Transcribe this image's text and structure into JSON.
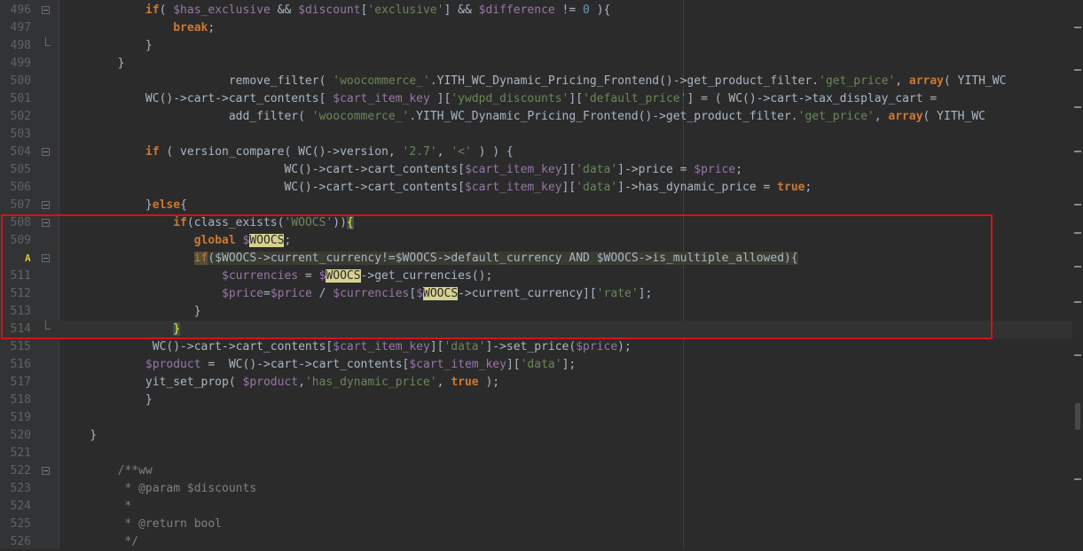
{
  "editor": {
    "current_line": "514",
    "lines": [
      {
        "n": "496",
        "fold": "open",
        "t": [
          [
            "            ",
            ""
          ],
          [
            "if",
            "kw"
          ],
          [
            "( ",
            ""
          ],
          [
            "$has_exclusive",
            "var"
          ],
          [
            " && ",
            ""
          ],
          [
            "$discount",
            "var"
          ],
          [
            "[",
            ""
          ],
          [
            "'exclusive'",
            "str"
          ],
          [
            "] && ",
            ""
          ],
          [
            "$difference",
            "var"
          ],
          [
            " != ",
            ""
          ],
          [
            "0",
            "num"
          ],
          [
            " ){",
            ""
          ]
        ]
      },
      {
        "n": "497",
        "t": [
          [
            "                ",
            ""
          ],
          [
            "break",
            "kw"
          ],
          [
            ";",
            ""
          ]
        ]
      },
      {
        "n": "498",
        "fold": "end",
        "t": [
          [
            "            }",
            ""
          ]
        ]
      },
      {
        "n": "499",
        "t": [
          [
            "        }",
            ""
          ]
        ]
      },
      {
        "n": "500",
        "t": [
          [
            "                        remove_filter( ",
            ""
          ],
          [
            "'woocommerce_'",
            "str"
          ],
          [
            ".YITH_WC_Dynamic_Pricing_Frontend()->get_product_filter.",
            ""
          ],
          [
            "'get_price'",
            "str"
          ],
          [
            ", ",
            ""
          ],
          [
            "array",
            "kw"
          ],
          [
            "( YITH_WC",
            ""
          ]
        ]
      },
      {
        "n": "501",
        "t": [
          [
            "            WC()->cart->cart_contents[ ",
            ""
          ],
          [
            "$cart_item_key",
            "var"
          ],
          [
            " ][",
            ""
          ],
          [
            "'ywdpd_discounts'",
            "str"
          ],
          [
            "][",
            ""
          ],
          [
            "'default_price'",
            "str"
          ],
          [
            "] = ( WC()->cart->tax_display_cart = ",
            ""
          ]
        ]
      },
      {
        "n": "502",
        "t": [
          [
            "                        add_filter( ",
            ""
          ],
          [
            "'woocommerce_'",
            "str"
          ],
          [
            ".YITH_WC_Dynamic_Pricing_Frontend()->get_product_filter.",
            ""
          ],
          [
            "'get_price'",
            "str"
          ],
          [
            ", ",
            ""
          ],
          [
            "array",
            "kw"
          ],
          [
            "( YITH_WC",
            ""
          ]
        ]
      },
      {
        "n": "503",
        "t": [
          [
            "",
            ""
          ]
        ]
      },
      {
        "n": "504",
        "fold": "open",
        "t": [
          [
            "            ",
            ""
          ],
          [
            "if",
            "kw"
          ],
          [
            " ( version_compare( WC()->version, ",
            ""
          ],
          [
            "'2.7'",
            "str"
          ],
          [
            ", ",
            ""
          ],
          [
            "'<'",
            "str"
          ],
          [
            " ) ) {",
            ""
          ]
        ]
      },
      {
        "n": "505",
        "t": [
          [
            "                                WC()->cart->cart_contents[",
            ""
          ],
          [
            "$cart_item_key",
            "var"
          ],
          [
            "][",
            ""
          ],
          [
            "'data'",
            "str"
          ],
          [
            "]->price = ",
            ""
          ],
          [
            "$price",
            "var"
          ],
          [
            ";",
            ""
          ]
        ]
      },
      {
        "n": "506",
        "t": [
          [
            "                                WC()->cart->cart_contents[",
            ""
          ],
          [
            "$cart_item_key",
            "var"
          ],
          [
            "][",
            ""
          ],
          [
            "'data'",
            "str"
          ],
          [
            "]->has_dynamic_price = ",
            ""
          ],
          [
            "true",
            "kw"
          ],
          [
            ";",
            ""
          ]
        ]
      },
      {
        "n": "507",
        "fold": "open",
        "t": [
          [
            "            }",
            ""
          ],
          [
            "else",
            "kw"
          ],
          [
            "{",
            ""
          ]
        ]
      },
      {
        "n": "508",
        "fold": "open",
        "t": [
          [
            "                ",
            ""
          ],
          [
            "if",
            "kw"
          ],
          [
            "(class_exists(",
            ""
          ],
          [
            "'WOOCS'",
            "str"
          ],
          [
            "))",
            ""
          ],
          [
            "{",
            "brace"
          ]
        ]
      },
      {
        "n": "509",
        "t": [
          [
            "                   ",
            ""
          ],
          [
            "global ",
            "kw"
          ],
          [
            "$",
            "var"
          ],
          [
            "WOOCS",
            "var-hl"
          ],
          [
            ";",
            ""
          ]
        ]
      },
      {
        "n": "510",
        "marker": "A",
        "fold": "open",
        "t": [
          [
            "                   ",
            ""
          ],
          [
            "if",
            "hlw"
          ],
          [
            "(",
            "lhl"
          ],
          [
            "$WOOCS",
            "lhl"
          ],
          [
            "->current_currency!=",
            "lhl"
          ],
          [
            "$WOOCS",
            "lhl"
          ],
          [
            "->default_currency AND ",
            "lhl"
          ],
          [
            "$WOOCS",
            "lhl"
          ],
          [
            "->is_multiple_allowed)",
            "lhl"
          ],
          [
            "{",
            "lhl"
          ]
        ]
      },
      {
        "n": "511",
        "t": [
          [
            "                       ",
            ""
          ],
          [
            "$currencies",
            "var"
          ],
          [
            " = ",
            ""
          ],
          [
            "$",
            "var"
          ],
          [
            "WOOCS",
            "var-hl"
          ],
          [
            "->get_currencies();",
            ""
          ]
        ]
      },
      {
        "n": "512",
        "t": [
          [
            "                       ",
            ""
          ],
          [
            "$price",
            "var"
          ],
          [
            "=",
            ""
          ],
          [
            "$price",
            "var"
          ],
          [
            " / ",
            ""
          ],
          [
            "$currencies",
            "var"
          ],
          [
            "[",
            ""
          ],
          [
            "$",
            "var"
          ],
          [
            "WOOCS",
            "var-hl"
          ],
          [
            "->current_currency][",
            ""
          ],
          [
            "'rate'",
            "str"
          ],
          [
            "];",
            ""
          ]
        ]
      },
      {
        "n": "513",
        "t": [
          [
            "                   }",
            ""
          ]
        ]
      },
      {
        "n": "514",
        "fold": "end",
        "t": [
          [
            "                ",
            ""
          ],
          [
            "}",
            "brace"
          ]
        ]
      },
      {
        "n": "515",
        "t": [
          [
            "             WC()->cart->cart_contents[",
            ""
          ],
          [
            "$cart_item_key",
            "var"
          ],
          [
            "][",
            ""
          ],
          [
            "'data'",
            "str"
          ],
          [
            "]->set_price(",
            ""
          ],
          [
            "$price",
            "var"
          ],
          [
            ");",
            ""
          ]
        ]
      },
      {
        "n": "516",
        "t": [
          [
            "            ",
            ""
          ],
          [
            "$product",
            "var"
          ],
          [
            " =  WC()->cart->cart_contents[",
            ""
          ],
          [
            "$cart_item_key",
            "var"
          ],
          [
            "][",
            ""
          ],
          [
            "'data'",
            "str"
          ],
          [
            "];",
            ""
          ]
        ]
      },
      {
        "n": "517",
        "t": [
          [
            "            yit_set_prop( ",
            ""
          ],
          [
            "$product",
            "var"
          ],
          [
            ",",
            ""
          ],
          [
            "'has_dynamic_price'",
            "str"
          ],
          [
            ", ",
            ""
          ],
          [
            "true",
            "kw"
          ],
          [
            " );",
            ""
          ]
        ]
      },
      {
        "n": "518",
        "t": [
          [
            "            }",
            ""
          ]
        ]
      },
      {
        "n": "519",
        "t": [
          [
            "",
            ""
          ]
        ]
      },
      {
        "n": "520",
        "t": [
          [
            "    }",
            ""
          ]
        ]
      },
      {
        "n": "521",
        "t": [
          [
            "",
            ""
          ]
        ]
      },
      {
        "n": "522",
        "fold": "open",
        "t": [
          [
            "        /**ww",
            "cmt"
          ]
        ]
      },
      {
        "n": "523",
        "t": [
          [
            "         * @param $discounts",
            "cmt"
          ]
        ]
      },
      {
        "n": "524",
        "t": [
          [
            "         *",
            "cmt"
          ]
        ]
      },
      {
        "n": "525",
        "t": [
          [
            "         * @return bool",
            "cmt"
          ]
        ]
      },
      {
        "n": "526",
        "t": [
          [
            "         */",
            "cmt"
          ]
        ]
      }
    ]
  },
  "colors": {
    "background": "#2b2b2b",
    "keyword": "#cc7832",
    "variable": "#9876aa",
    "string": "#6a8759",
    "number": "#6897bb",
    "comment": "#808080",
    "annotation_box": "#d2131b"
  }
}
